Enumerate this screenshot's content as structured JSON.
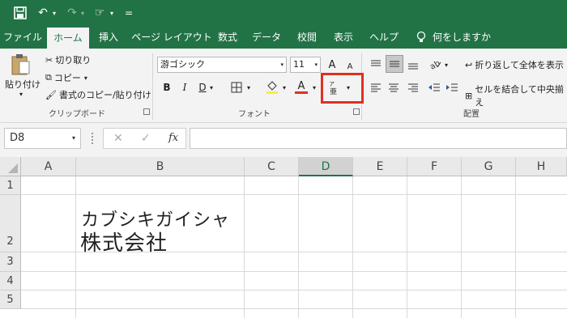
{
  "qat": {
    "save_icon": "save-icon",
    "undo_glyph": "↶",
    "redo_glyph": "↷",
    "touch_glyph": "☞",
    "customize_glyph": "="
  },
  "tabs": [
    {
      "label": "ファイル"
    },
    {
      "label": "ホーム",
      "active": true
    },
    {
      "label": "挿入"
    },
    {
      "label": "ページ レイアウト"
    },
    {
      "label": "数式"
    },
    {
      "label": "データ"
    },
    {
      "label": "校閲"
    },
    {
      "label": "表示"
    },
    {
      "label": "ヘルプ"
    },
    {
      "label": "何をしますか"
    }
  ],
  "clipboard": {
    "paste_label": "貼り付け",
    "cut_label": "切り取り",
    "copy_label": "コピー",
    "format_painter_label": "書式のコピー/貼り付け",
    "group_label": "クリップボード"
  },
  "font": {
    "font_name": "游ゴシック",
    "font_size": "11",
    "grow_label": "A",
    "shrink_label": "A",
    "bold": "B",
    "italic": "I",
    "underline": "D",
    "font_color_glyph": "A",
    "group_label": "フォント"
  },
  "alignment": {
    "wrap_label": "折り返して全体を表示",
    "merge_label": "セルを結合して中央揃え",
    "group_label": "配置"
  },
  "formula_bar": {
    "name_box": "D8",
    "cancel_glyph": "✕",
    "enter_glyph": "✓",
    "fx_label": "fx",
    "formula": ""
  },
  "sheet": {
    "columns": [
      "A",
      "B",
      "C",
      "D",
      "E",
      "F",
      "G",
      "H"
    ],
    "selected_column": "D",
    "rows": [
      "1",
      "2",
      "3",
      "4",
      "5"
    ],
    "cell_b2_furigana": "カブシキガイシャ",
    "cell_b2_value": "株式会社"
  },
  "colors": {
    "accent": "#217346",
    "highlight": "#e03020"
  }
}
